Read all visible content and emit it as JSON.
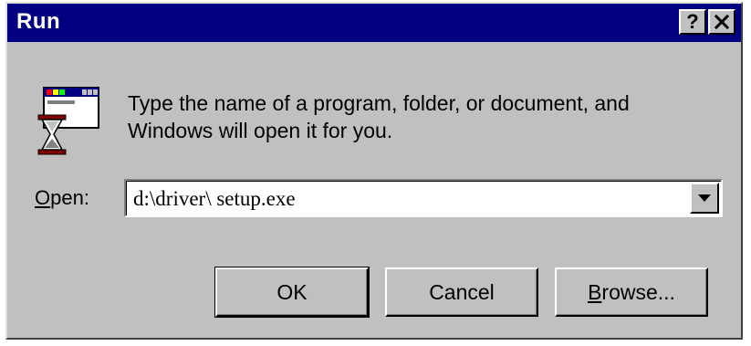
{
  "window": {
    "title": "Run",
    "help_button": "?",
    "close_button": "×"
  },
  "icon": {
    "name": "run-program-icon"
  },
  "message": {
    "line1": "Type the name of a program, folder, or document, and",
    "line2": "Windows will open it for you."
  },
  "open_field": {
    "label_prefix": "O",
    "label_rest": "pen:",
    "value": "d:\\driver\\ setup.exe",
    "dropdown_icon": "dropdown-arrow-icon"
  },
  "buttons": {
    "ok": "OK",
    "cancel": "Cancel",
    "browse_prefix": "B",
    "browse_rest": "rowse..."
  },
  "colors": {
    "titlebar": "#000080",
    "face": "#c0c0c0"
  }
}
